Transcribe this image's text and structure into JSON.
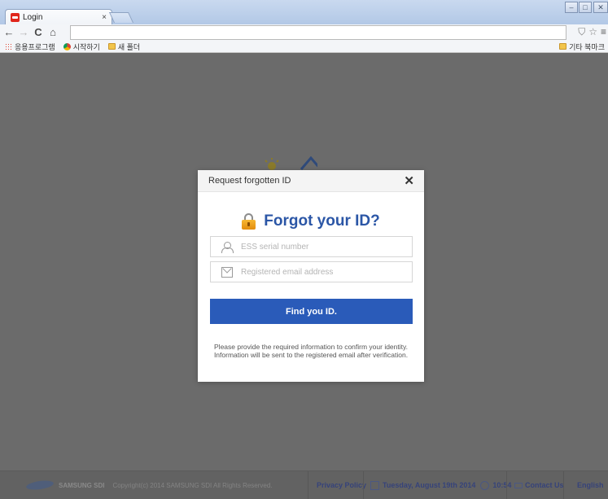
{
  "browser": {
    "tab_title": "Login",
    "tab_close": "×",
    "url": "",
    "window_controls": {
      "minimize": "–",
      "maximize": "□",
      "close": "✕"
    },
    "nav": {
      "back": "←",
      "forward": "→",
      "reload": "C",
      "home": "⌂"
    },
    "toolbar_icons": {
      "shield": "⛉",
      "star": "☆",
      "menu": "≡"
    },
    "bookmarks": [
      {
        "label": "응용프로그램",
        "icon": "apps-icon"
      },
      {
        "label": "시작하기",
        "icon": "chrome-icon"
      },
      {
        "label": "새 폴더",
        "icon": "folder-icon"
      }
    ],
    "other_bookmarks": "기타 북마크"
  },
  "modal": {
    "title": "Request forgotten ID",
    "close": "✕",
    "heading": "Forgot your ID?",
    "serial_placeholder": "ESS serial number",
    "email_placeholder": "Registered email address",
    "submit_label": "Find you ID.",
    "note_line1": "Please provide the required information to confirm your identity.",
    "note_line2": "Information will be sent to the registered email after verification."
  },
  "footer": {
    "brand": "SAMSUNG SDI",
    "copyright": "Copyright(c) 2014 SAMSUNG SDI All Rights Reserved.",
    "privacy": "Privacy Policy",
    "date": "Tuesday, August 19th 2014",
    "time": "10:54",
    "contact": "Contact Us",
    "language": "English"
  },
  "colors": {
    "accent": "#2a5bb9",
    "heading": "#2b56a6",
    "overlay": "#6b6b6b"
  }
}
